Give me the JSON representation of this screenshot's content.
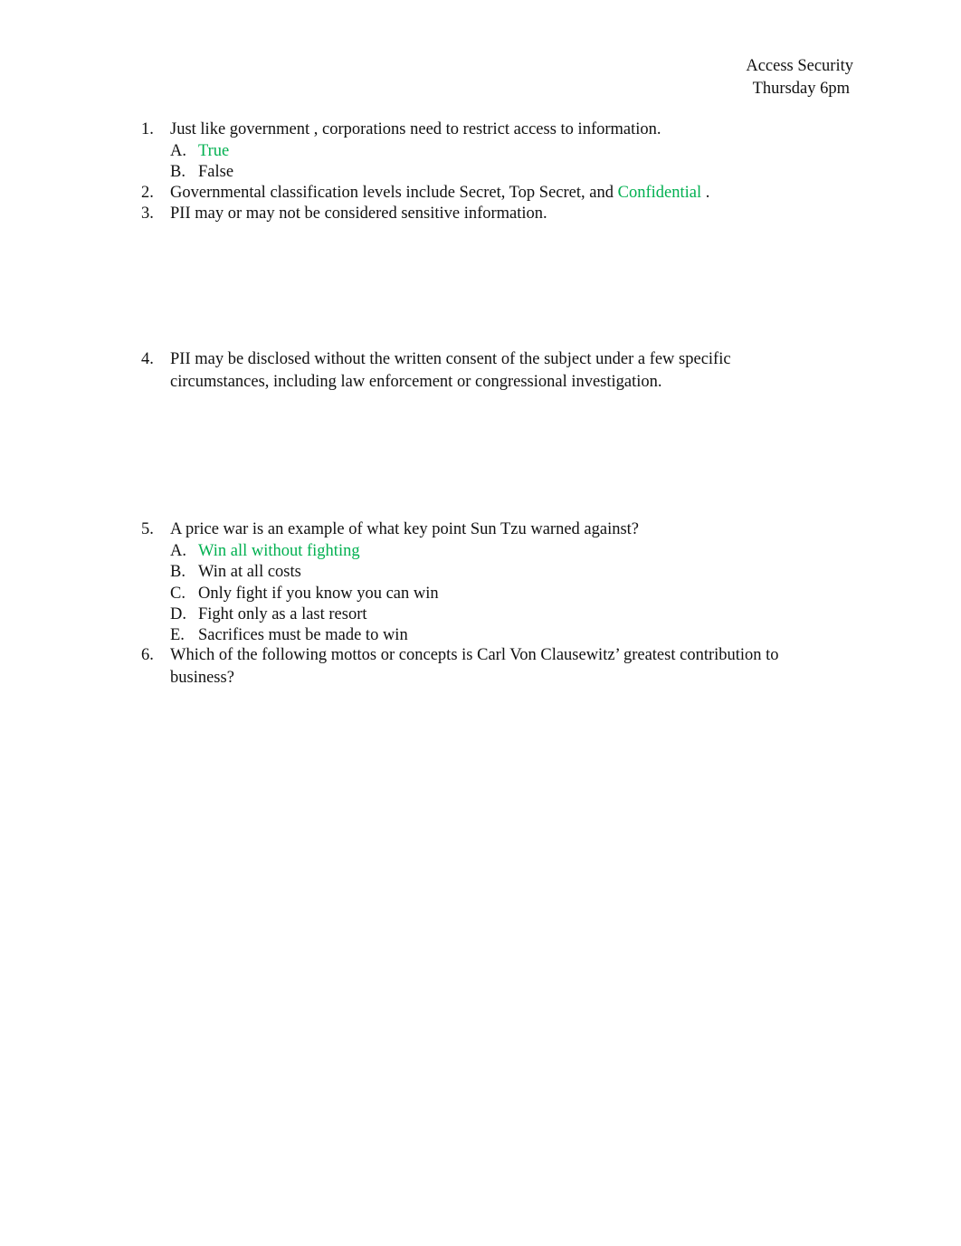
{
  "header": {
    "course": "Access Security",
    "session": "Thursday 6pm"
  },
  "colors": {
    "answer": "#00b050",
    "text": "#111111"
  },
  "questions": [
    {
      "number": "1.",
      "text": "Just like government , corporations need to restrict access to information.",
      "options": [
        {
          "letter": "A.",
          "text": "True",
          "highlighted": true
        },
        {
          "letter": "B.",
          "text": "False",
          "highlighted": false
        }
      ]
    },
    {
      "number": "2.",
      "text_before": "Governmental classification levels include Secret, Top Secret, and ",
      "answer": "Confidential",
      "text_after": " ."
    },
    {
      "number": "3.",
      "text": "PII may or may not be considered sensitive information."
    },
    {
      "number": "4.",
      "text": "PII may be disclosed without the written consent of the subject under a few specific circumstances, including law enforcement or congressional investigation."
    },
    {
      "number": "5.",
      "text": "A price war is an example of what key point Sun Tzu warned against?",
      "options": [
        {
          "letter": "A.",
          "text": "Win all without fighting",
          "highlighted": true
        },
        {
          "letter": "B.",
          "text": "Win at all costs",
          "highlighted": false
        },
        {
          "letter": "C.",
          "text": "Only fight if you know you can win",
          "highlighted": false
        },
        {
          "letter": "D.",
          "text": "Fight only as a last resort",
          "highlighted": false
        },
        {
          "letter": "E.",
          "text": "Sacrifices must be made to win",
          "highlighted": false
        }
      ]
    },
    {
      "number": "6.",
      "text": "Which of the following mottos or concepts is Carl Von Clausewitz’ greatest contribution to business?"
    }
  ]
}
